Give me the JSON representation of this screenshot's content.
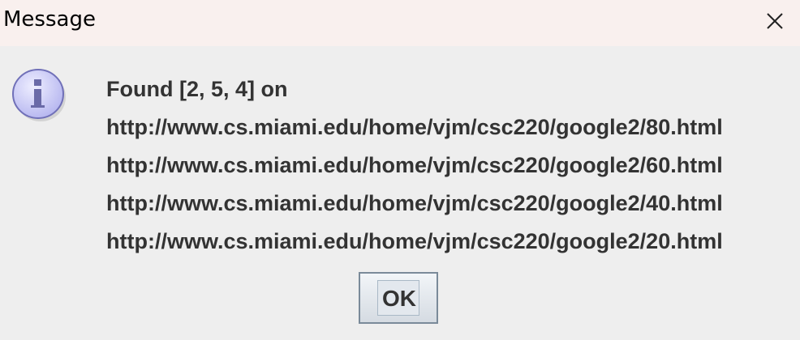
{
  "window": {
    "title": "Message",
    "close_icon": "close-icon"
  },
  "dialog": {
    "icon": "info-icon",
    "message_lines": [
      "Found [2, 5, 4] on",
      "http://www.cs.miami.edu/home/vjm/csc220/google2/80.html",
      "http://www.cs.miami.edu/home/vjm/csc220/google2/60.html",
      "http://www.cs.miami.edu/home/vjm/csc220/google2/40.html",
      "http://www.cs.miami.edu/home/vjm/csc220/google2/20.html"
    ],
    "ok_label": "OK"
  },
  "colors": {
    "titlebar_bg": "#f9f0ee",
    "dialog_bg": "#eeeeee",
    "text": "#333333",
    "icon_fill": "#ccccff",
    "icon_border": "#8080c0"
  }
}
